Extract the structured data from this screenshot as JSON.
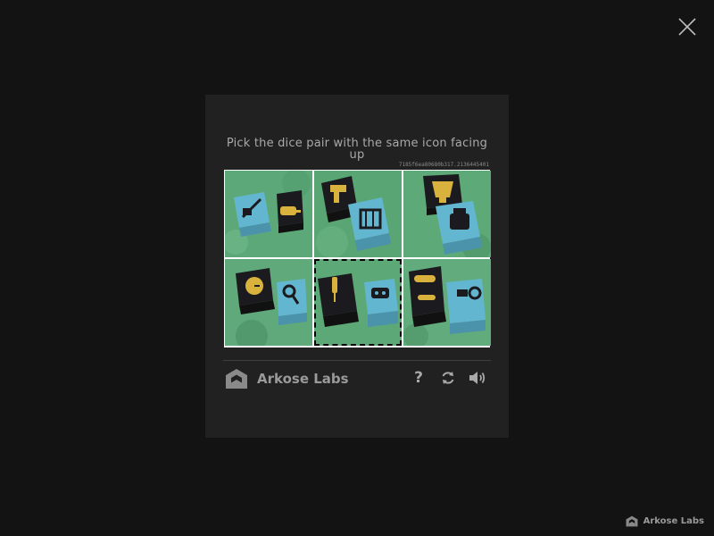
{
  "challenge": {
    "prompt": "Pick the dice pair with the same icon facing up",
    "session_id": "7185f6ea80680b317.2136445401",
    "selected_tile": 5,
    "tiles": [
      {
        "index": 1,
        "dice": [
          {
            "color": "light-blue",
            "icon": "syringe"
          },
          {
            "color": "black",
            "icon": "trowel"
          }
        ]
      },
      {
        "index": 2,
        "dice": [
          {
            "color": "black",
            "icon": "drill"
          },
          {
            "color": "light-blue",
            "icon": "toaster"
          }
        ]
      },
      {
        "index": 3,
        "dice": [
          {
            "color": "black",
            "icon": "cocktail-shaker"
          },
          {
            "color": "light-blue",
            "icon": "kettle"
          }
        ]
      },
      {
        "index": 4,
        "dice": [
          {
            "color": "black",
            "icon": "clock"
          },
          {
            "color": "light-blue",
            "icon": "magnifier"
          }
        ]
      },
      {
        "index": 5,
        "dice": [
          {
            "color": "black",
            "icon": "screwdriver"
          },
          {
            "color": "light-blue",
            "icon": "radio"
          }
        ]
      },
      {
        "index": 6,
        "dice": [
          {
            "color": "black",
            "icon": "hose"
          },
          {
            "color": "light-blue",
            "icon": "saw-blade"
          }
        ]
      }
    ]
  },
  "brand": {
    "name": "Arkose Labs",
    "footer_name": "Arkose Labs"
  },
  "controls": {
    "help_label": "?",
    "refresh_icon": "refresh-icon",
    "audio_icon": "speaker-icon"
  },
  "colors": {
    "backdrop": "#131313",
    "modal": "#212121",
    "text": "#a9a9a9",
    "felt": "#5da879",
    "die_blue": "#63b6d0",
    "die_black": "#1b1b1f",
    "icon_gold": "#d9b23e"
  }
}
